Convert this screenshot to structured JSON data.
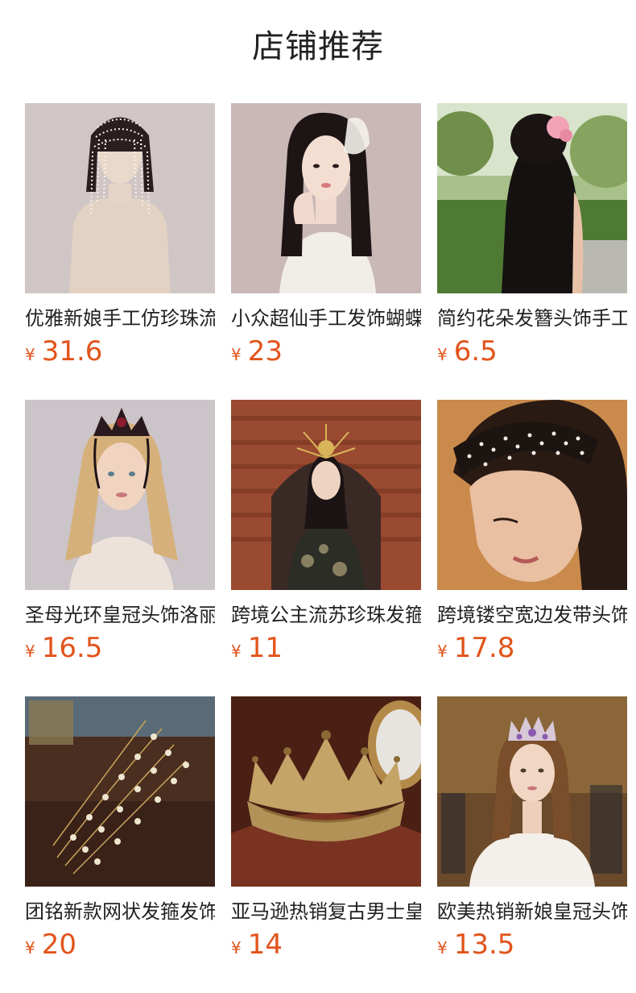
{
  "header": {
    "title": "店铺推荐"
  },
  "currency": "¥",
  "products": [
    {
      "title": "优雅新娘手工仿珍珠流苏",
      "price": "31.6",
      "image": "pearl-headpiece-mannequin"
    },
    {
      "title": "小众超仙手工发饰蝴蝶结",
      "price": "23",
      "image": "bride-with-floral-hairpiece"
    },
    {
      "title": "简约花朵发簪头饰手工",
      "price": "6.5",
      "image": "woman-back-flower-hairpin"
    },
    {
      "title": "圣母光环皇冠头饰洛丽塔",
      "price": "16.5",
      "image": "blonde-woman-dark-crown"
    },
    {
      "title": "跨境公主流苏珍珠发箍",
      "price": "11",
      "image": "woman-gold-halo-crown-brick-arch"
    },
    {
      "title": "跨境镂空宽边发带头饰",
      "price": "17.8",
      "image": "woman-rhinestone-headband"
    },
    {
      "title": "团铭新款网状发箍发饰",
      "price": "20",
      "image": "pearl-net-hair-vine"
    },
    {
      "title": "亚马逊热销复古男士皇冠",
      "price": "14",
      "image": "gold-baroque-crown"
    },
    {
      "title": "欧美热销新娘皇冠头饰",
      "price": "13.5",
      "image": "bride-purple-crown"
    }
  ],
  "colors": {
    "price": "#e2541b",
    "text": "#222222"
  }
}
